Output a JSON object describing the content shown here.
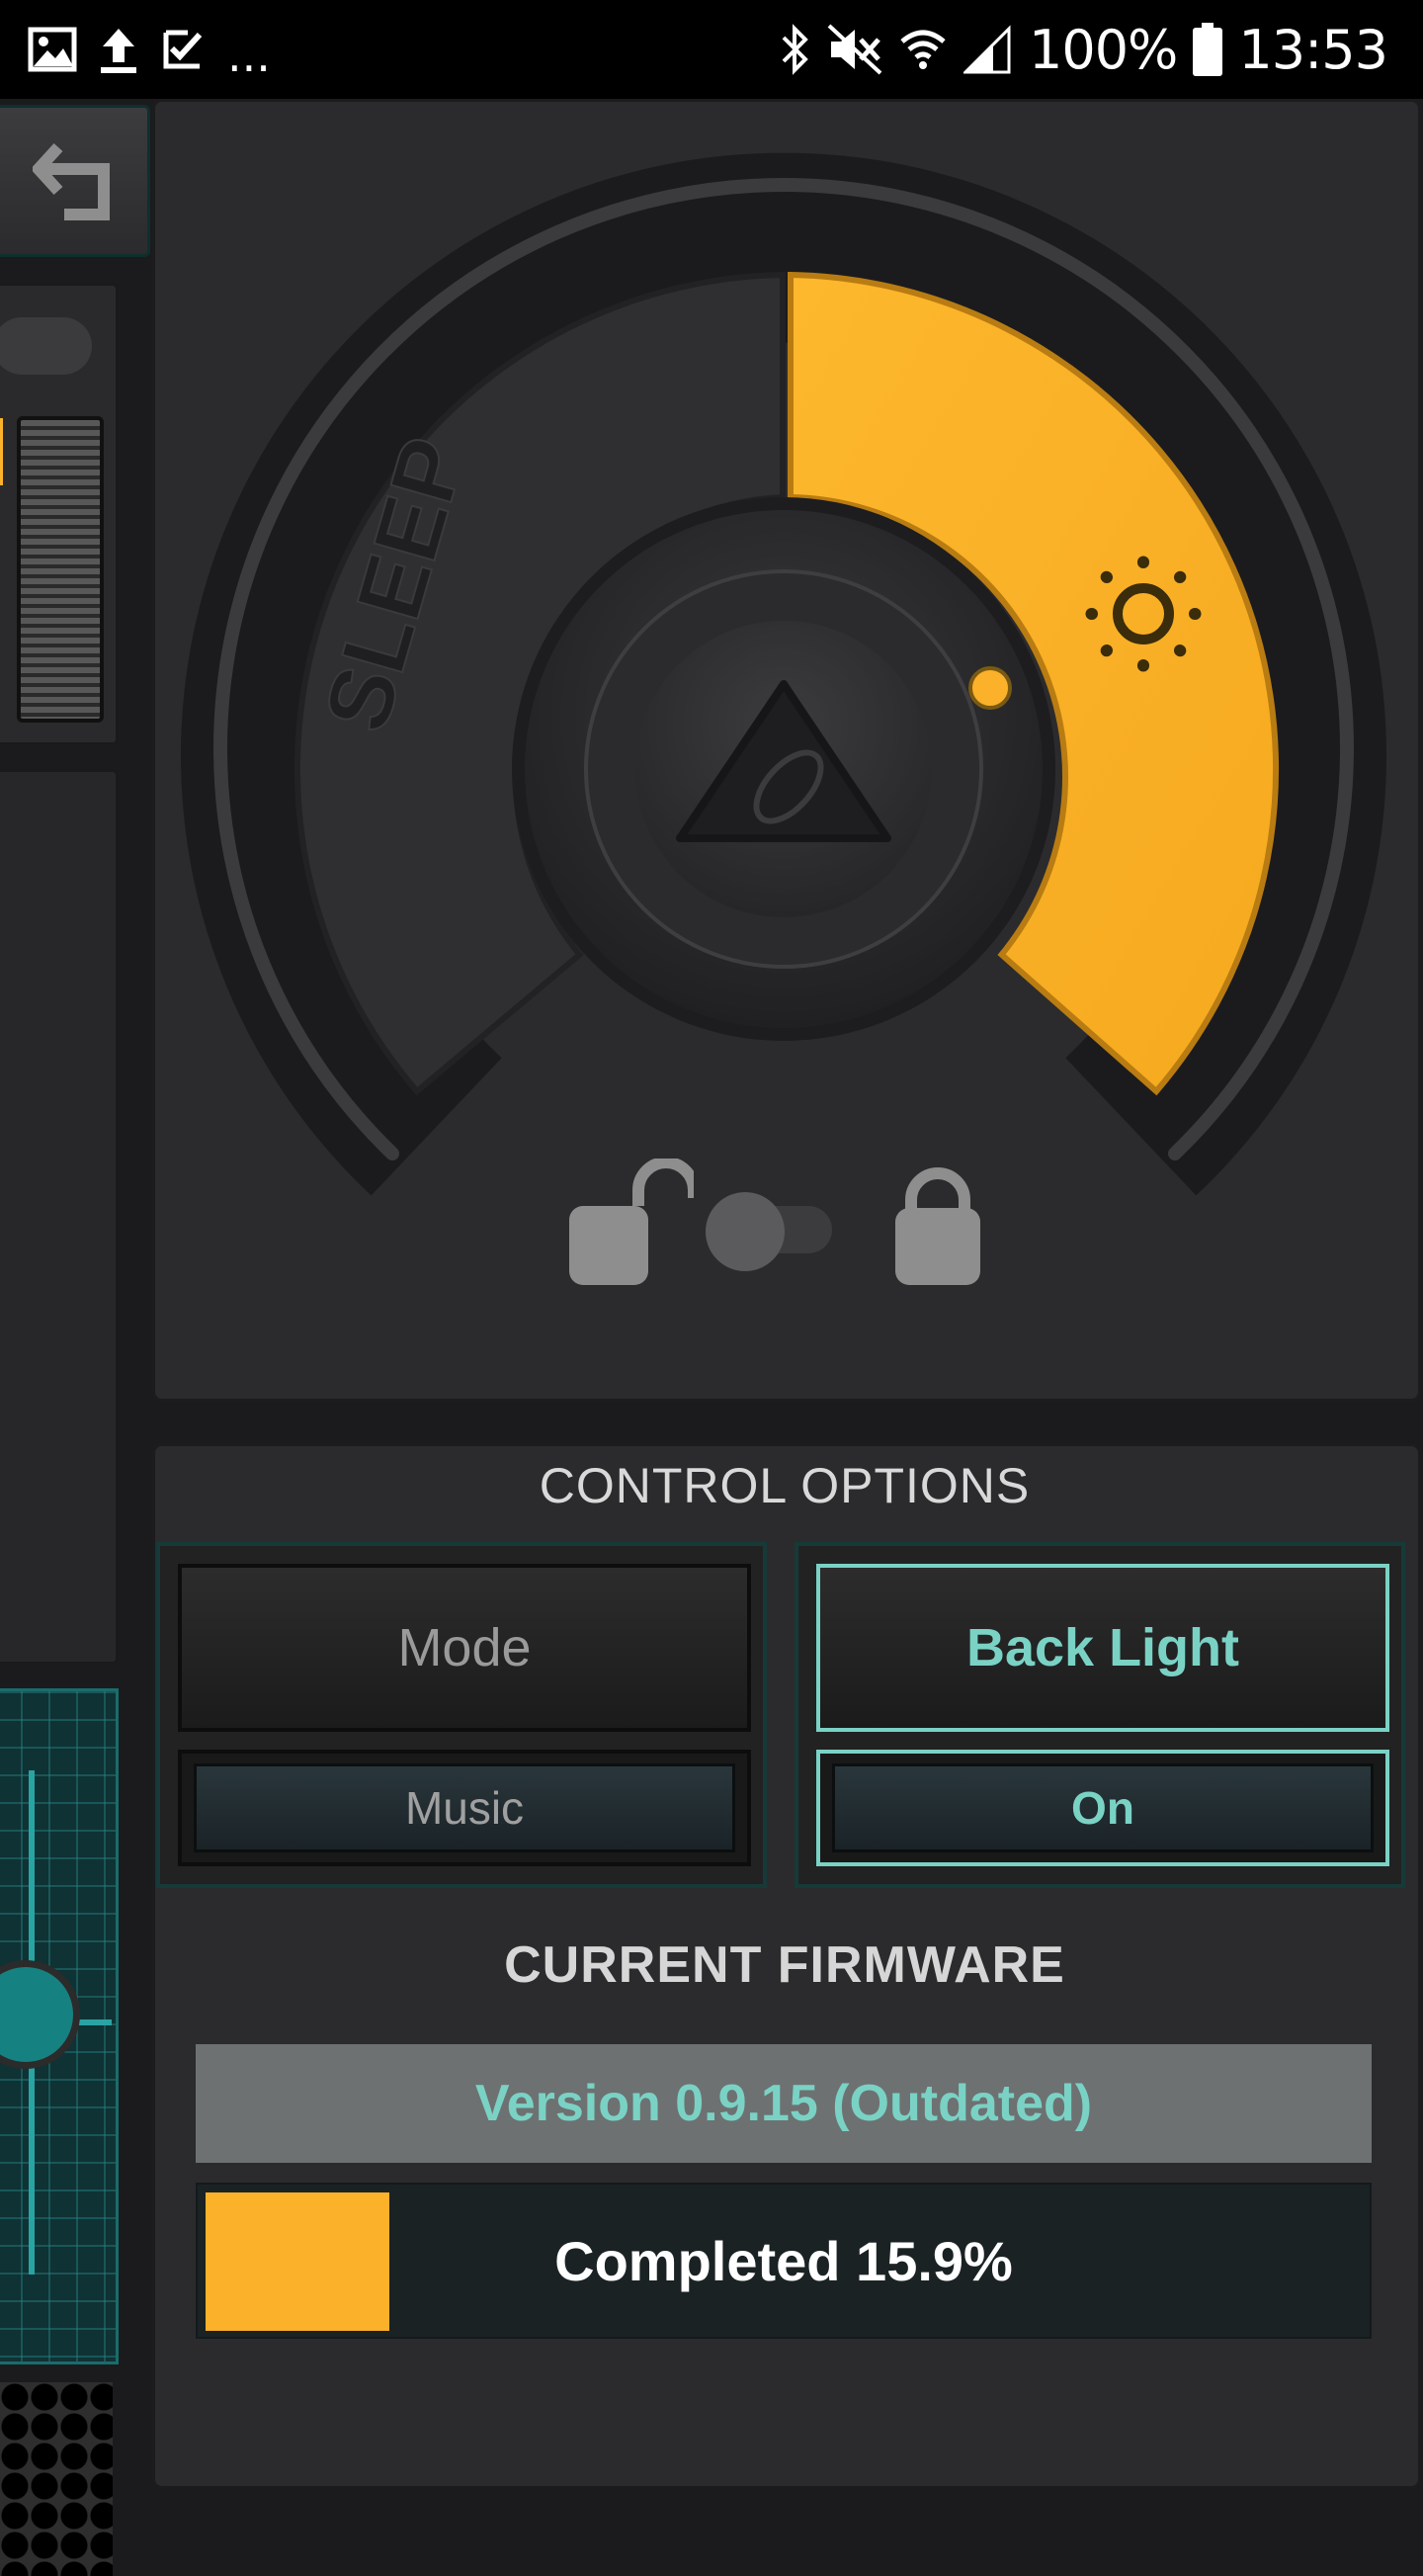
{
  "status_bar": {
    "more_indicator": "...",
    "battery": "100%",
    "time": "13:53"
  },
  "dial": {
    "sleep_label": "SLEEP",
    "accent": "#fbb12a"
  },
  "control_options": {
    "title": "CONTROL OPTIONS",
    "left": {
      "top_label": "Mode",
      "bottom_label": "Music"
    },
    "right": {
      "top_label": "Back Light",
      "bottom_label": "On"
    },
    "active_color": "#7ad2c5"
  },
  "firmware": {
    "title": "CURRENT FIRMWARE",
    "version": "Version 0.9.15 (Outdated)",
    "progress_text": "Completed 15.9%",
    "progress_fraction": 0.159,
    "progress_color": "#fbb12a"
  }
}
